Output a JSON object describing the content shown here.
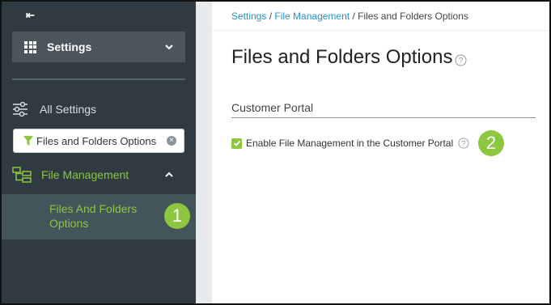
{
  "sidebar": {
    "collapse_glyph": "⇤",
    "header_label": "Settings",
    "all_settings_label": "All Settings",
    "filter": {
      "value": "Files and Folders Options",
      "placeholder": ""
    },
    "file_management_label": "File Management",
    "active_item_label": "Files And Folders Options"
  },
  "breadcrumb": {
    "items": [
      "Settings",
      "File Management",
      "Files and Folders Options"
    ],
    "separator": "/"
  },
  "main": {
    "title": "Files and Folders Options",
    "section_title": "Customer Portal",
    "option_label": "Enable File Management in the Customer Portal",
    "option_checked": true
  },
  "badges": [
    "1",
    "2"
  ],
  "colors": {
    "accent": "#8dc63f",
    "link": "#2a8fc7",
    "sidebar_bg": "#2f3b40",
    "sidebar_active_bg": "#44545b",
    "settings_header_bg": "#4a565b"
  },
  "icons": {
    "collapse": "collapse-sidebar-icon",
    "settings": "grid-icon",
    "all_settings": "sliders-icon",
    "filter": "funnel-icon",
    "file_management": "folder-tree-icon",
    "help": "help-icon",
    "clear": "clear-icon"
  }
}
